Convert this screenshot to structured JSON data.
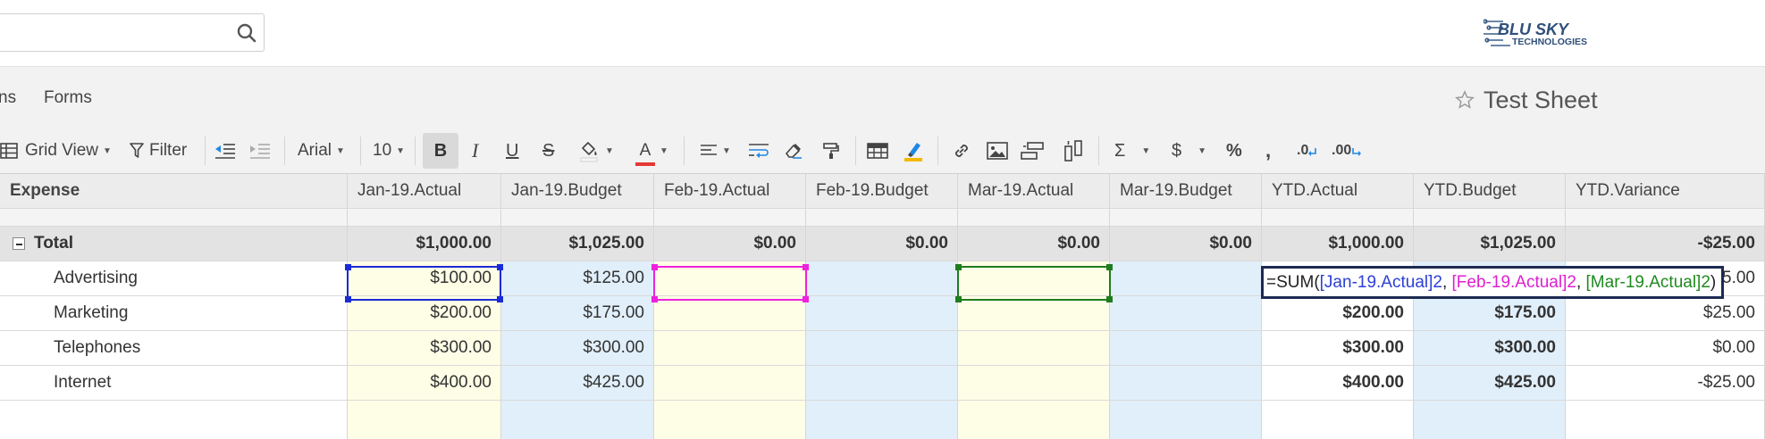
{
  "search": {
    "placeholder": ""
  },
  "logo": {
    "line1": "BLU SKY",
    "line2": "TECHNOLOGIES"
  },
  "nav": {
    "items": [
      "ns",
      "Forms"
    ],
    "sheet_title": "Test Sheet"
  },
  "toolbar": {
    "grid_view": "Grid View",
    "filter": "Filter",
    "font_family": "Arial",
    "font_size": "10",
    "bold": "B",
    "italic": "I",
    "underline": "U",
    "strike": "S",
    "font_color_letter": "A",
    "sum": "Σ",
    "currency": "$",
    "percent": "%",
    "comma": ",",
    "dec_down": ".0",
    "dec_up": ".00",
    "colors": {
      "font_color_bar": "#e53935",
      "highlight_bar": "#f5b800",
      "arrow_blue": "#1e88e5"
    }
  },
  "grid": {
    "columns": [
      "Expense",
      "Jan-19.Actual",
      "Jan-19.Budget",
      "Feb-19.Actual",
      "Feb-19.Budget",
      "Mar-19.Actual",
      "Mar-19.Budget",
      "YTD.Actual",
      "YTD.Budget",
      "YTD.Variance"
    ],
    "total": {
      "label": "Total",
      "values": [
        "$1,000.00",
        "$1,025.00",
        "$0.00",
        "$0.00",
        "$0.00",
        "$0.00",
        "$1,000.00",
        "$1,025.00",
        "-$25.00"
      ]
    },
    "rows": [
      {
        "label": "Advertising",
        "values": [
          "$100.00",
          "$125.00",
          "",
          "",
          "",
          "",
          "",
          "",
          "5.00"
        ]
      },
      {
        "label": "Marketing",
        "values": [
          "$200.00",
          "$175.00",
          "",
          "",
          "",
          "",
          "$200.00",
          "$175.00",
          "$25.00"
        ]
      },
      {
        "label": "Telephones",
        "values": [
          "$300.00",
          "$300.00",
          "",
          "",
          "",
          "",
          "$300.00",
          "$300.00",
          "$0.00"
        ]
      },
      {
        "label": "Internet",
        "values": [
          "$400.00",
          "$425.00",
          "",
          "",
          "",
          "",
          "$400.00",
          "$425.00",
          "-$25.00"
        ]
      }
    ]
  },
  "formula": {
    "prefix": "=SUM(",
    "ref1": "[Jan-19.Actual]2",
    "sep1": ", ",
    "ref2": "[Feb-19.Actual]2",
    "sep2": ", ",
    "ref3": "[Mar-19.Actual]2",
    "suffix": ")",
    "colors": {
      "ref1": "#2d3fd8",
      "ref2": "#e01fd0",
      "ref3": "#1f8a1f"
    }
  },
  "selection_colors": {
    "jan": "#1a2bd6",
    "feb": "#ee22dd",
    "mar": "#1e7d1e"
  }
}
